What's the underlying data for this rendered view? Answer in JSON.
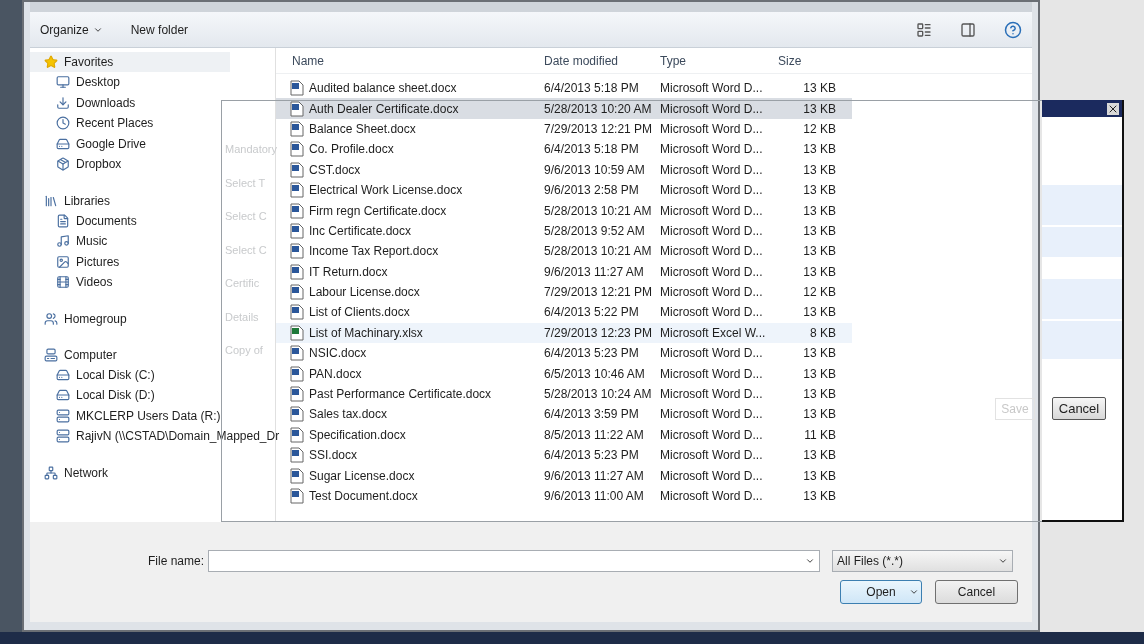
{
  "toolbar": {
    "organize": "Organize",
    "new_folder": "New folder"
  },
  "nav": [
    {
      "label": "Favorites",
      "children": [
        {
          "label": "Desktop"
        },
        {
          "label": "Downloads"
        },
        {
          "label": "Recent Places"
        },
        {
          "label": "Google Drive"
        },
        {
          "label": "Dropbox"
        }
      ]
    },
    {
      "label": "Libraries",
      "children": [
        {
          "label": "Documents"
        },
        {
          "label": "Music"
        },
        {
          "label": "Pictures"
        },
        {
          "label": "Videos"
        }
      ]
    },
    {
      "label": "Homegroup"
    },
    {
      "label": "Computer",
      "children": [
        {
          "label": "Local Disk (C:)"
        },
        {
          "label": "Local Disk (D:)"
        },
        {
          "label": "MKCLERP Users Data (R:)"
        },
        {
          "label": "RajivN (\\\\CSTAD\\Domain_Mapped_Dr"
        }
      ]
    },
    {
      "label": "Network"
    }
  ],
  "columns": [
    "Name",
    "Date modified",
    "Type",
    "Size"
  ],
  "files": [
    {
      "kind": "word",
      "name": "Audited balance sheet.docx",
      "date": "6/4/2013 5:18 PM",
      "type": "Microsoft Word D...",
      "size": "13 KB",
      "selected": false
    },
    {
      "kind": "word",
      "name": "Auth Dealer Certificate.docx",
      "date": "5/28/2013 10:20 AM",
      "type": "Microsoft Word D...",
      "size": "13 KB",
      "selected": true
    },
    {
      "kind": "word",
      "name": "Balance Sheet.docx",
      "date": "7/29/2013 12:21 PM",
      "type": "Microsoft Word D...",
      "size": "12 KB",
      "selected": false
    },
    {
      "kind": "word",
      "name": "Co. Profile.docx",
      "date": "6/4/2013 5:18 PM",
      "type": "Microsoft Word D...",
      "size": "13 KB",
      "selected": false
    },
    {
      "kind": "word",
      "name": "CST.docx",
      "date": "9/6/2013 10:59 AM",
      "type": "Microsoft Word D...",
      "size": "13 KB",
      "selected": false
    },
    {
      "kind": "word",
      "name": "Electrical Work License.docx",
      "date": "9/6/2013 2:58 PM",
      "type": "Microsoft Word D...",
      "size": "13 KB",
      "selected": false
    },
    {
      "kind": "word",
      "name": "Firm regn Certificate.docx",
      "date": "5/28/2013 10:21 AM",
      "type": "Microsoft Word D...",
      "size": "13 KB",
      "selected": false
    },
    {
      "kind": "word",
      "name": "Inc Certificate.docx",
      "date": "5/28/2013 9:52 AM",
      "type": "Microsoft Word D...",
      "size": "13 KB",
      "selected": false
    },
    {
      "kind": "word",
      "name": "Income Tax Report.docx",
      "date": "5/28/2013 10:21 AM",
      "type": "Microsoft Word D...",
      "size": "13 KB",
      "selected": false
    },
    {
      "kind": "word",
      "name": "IT Return.docx",
      "date": "9/6/2013 11:27 AM",
      "type": "Microsoft Word D...",
      "size": "13 KB",
      "selected": false
    },
    {
      "kind": "word",
      "name": "Labour License.docx",
      "date": "7/29/2013 12:21 PM",
      "type": "Microsoft Word D...",
      "size": "12 KB",
      "selected": false
    },
    {
      "kind": "word",
      "name": "List of Clients.docx",
      "date": "6/4/2013 5:22 PM",
      "type": "Microsoft Word D...",
      "size": "13 KB",
      "selected": false
    },
    {
      "kind": "excel",
      "name": "List of Machinary.xlsx",
      "date": "7/29/2013 12:23 PM",
      "type": "Microsoft Excel W...",
      "size": "8 KB",
      "selected": false
    },
    {
      "kind": "word",
      "name": "NSIC.docx",
      "date": "6/4/2013 5:23 PM",
      "type": "Microsoft Word D...",
      "size": "13 KB",
      "selected": false
    },
    {
      "kind": "word",
      "name": "PAN.docx",
      "date": "6/5/2013 10:46 AM",
      "type": "Microsoft Word D...",
      "size": "13 KB",
      "selected": false
    },
    {
      "kind": "word",
      "name": "Past Performance Certificate.docx",
      "date": "5/28/2013 10:24 AM",
      "type": "Microsoft Word D...",
      "size": "13 KB",
      "selected": false
    },
    {
      "kind": "word",
      "name": "Sales tax.docx",
      "date": "6/4/2013 3:59 PM",
      "type": "Microsoft Word D...",
      "size": "13 KB",
      "selected": false
    },
    {
      "kind": "word",
      "name": "Specification.docx",
      "date": "8/5/2013 11:22 AM",
      "type": "Microsoft Word D...",
      "size": "11 KB",
      "selected": false
    },
    {
      "kind": "word",
      "name": "SSI.docx",
      "date": "6/4/2013 5:23 PM",
      "type": "Microsoft Word D...",
      "size": "13 KB",
      "selected": false
    },
    {
      "kind": "word",
      "name": "Sugar License.docx",
      "date": "9/6/2013 11:27 AM",
      "type": "Microsoft Word D...",
      "size": "13 KB",
      "selected": false
    },
    {
      "kind": "word",
      "name": "Test Document.docx",
      "date": "9/6/2013 11:00 AM",
      "type": "Microsoft Word D...",
      "size": "13 KB",
      "selected": false
    }
  ],
  "ghost_dialog": {
    "labels": [
      "Mandatory",
      "Select T",
      "Select C",
      "Select C",
      "Certific",
      "Details",
      "Copy of"
    ],
    "save": "Save",
    "cancel": "Cancel"
  },
  "footer": {
    "file_name_label": "File name:",
    "filter": "All Files (*.*)",
    "open": "Open",
    "cancel": "Cancel"
  }
}
